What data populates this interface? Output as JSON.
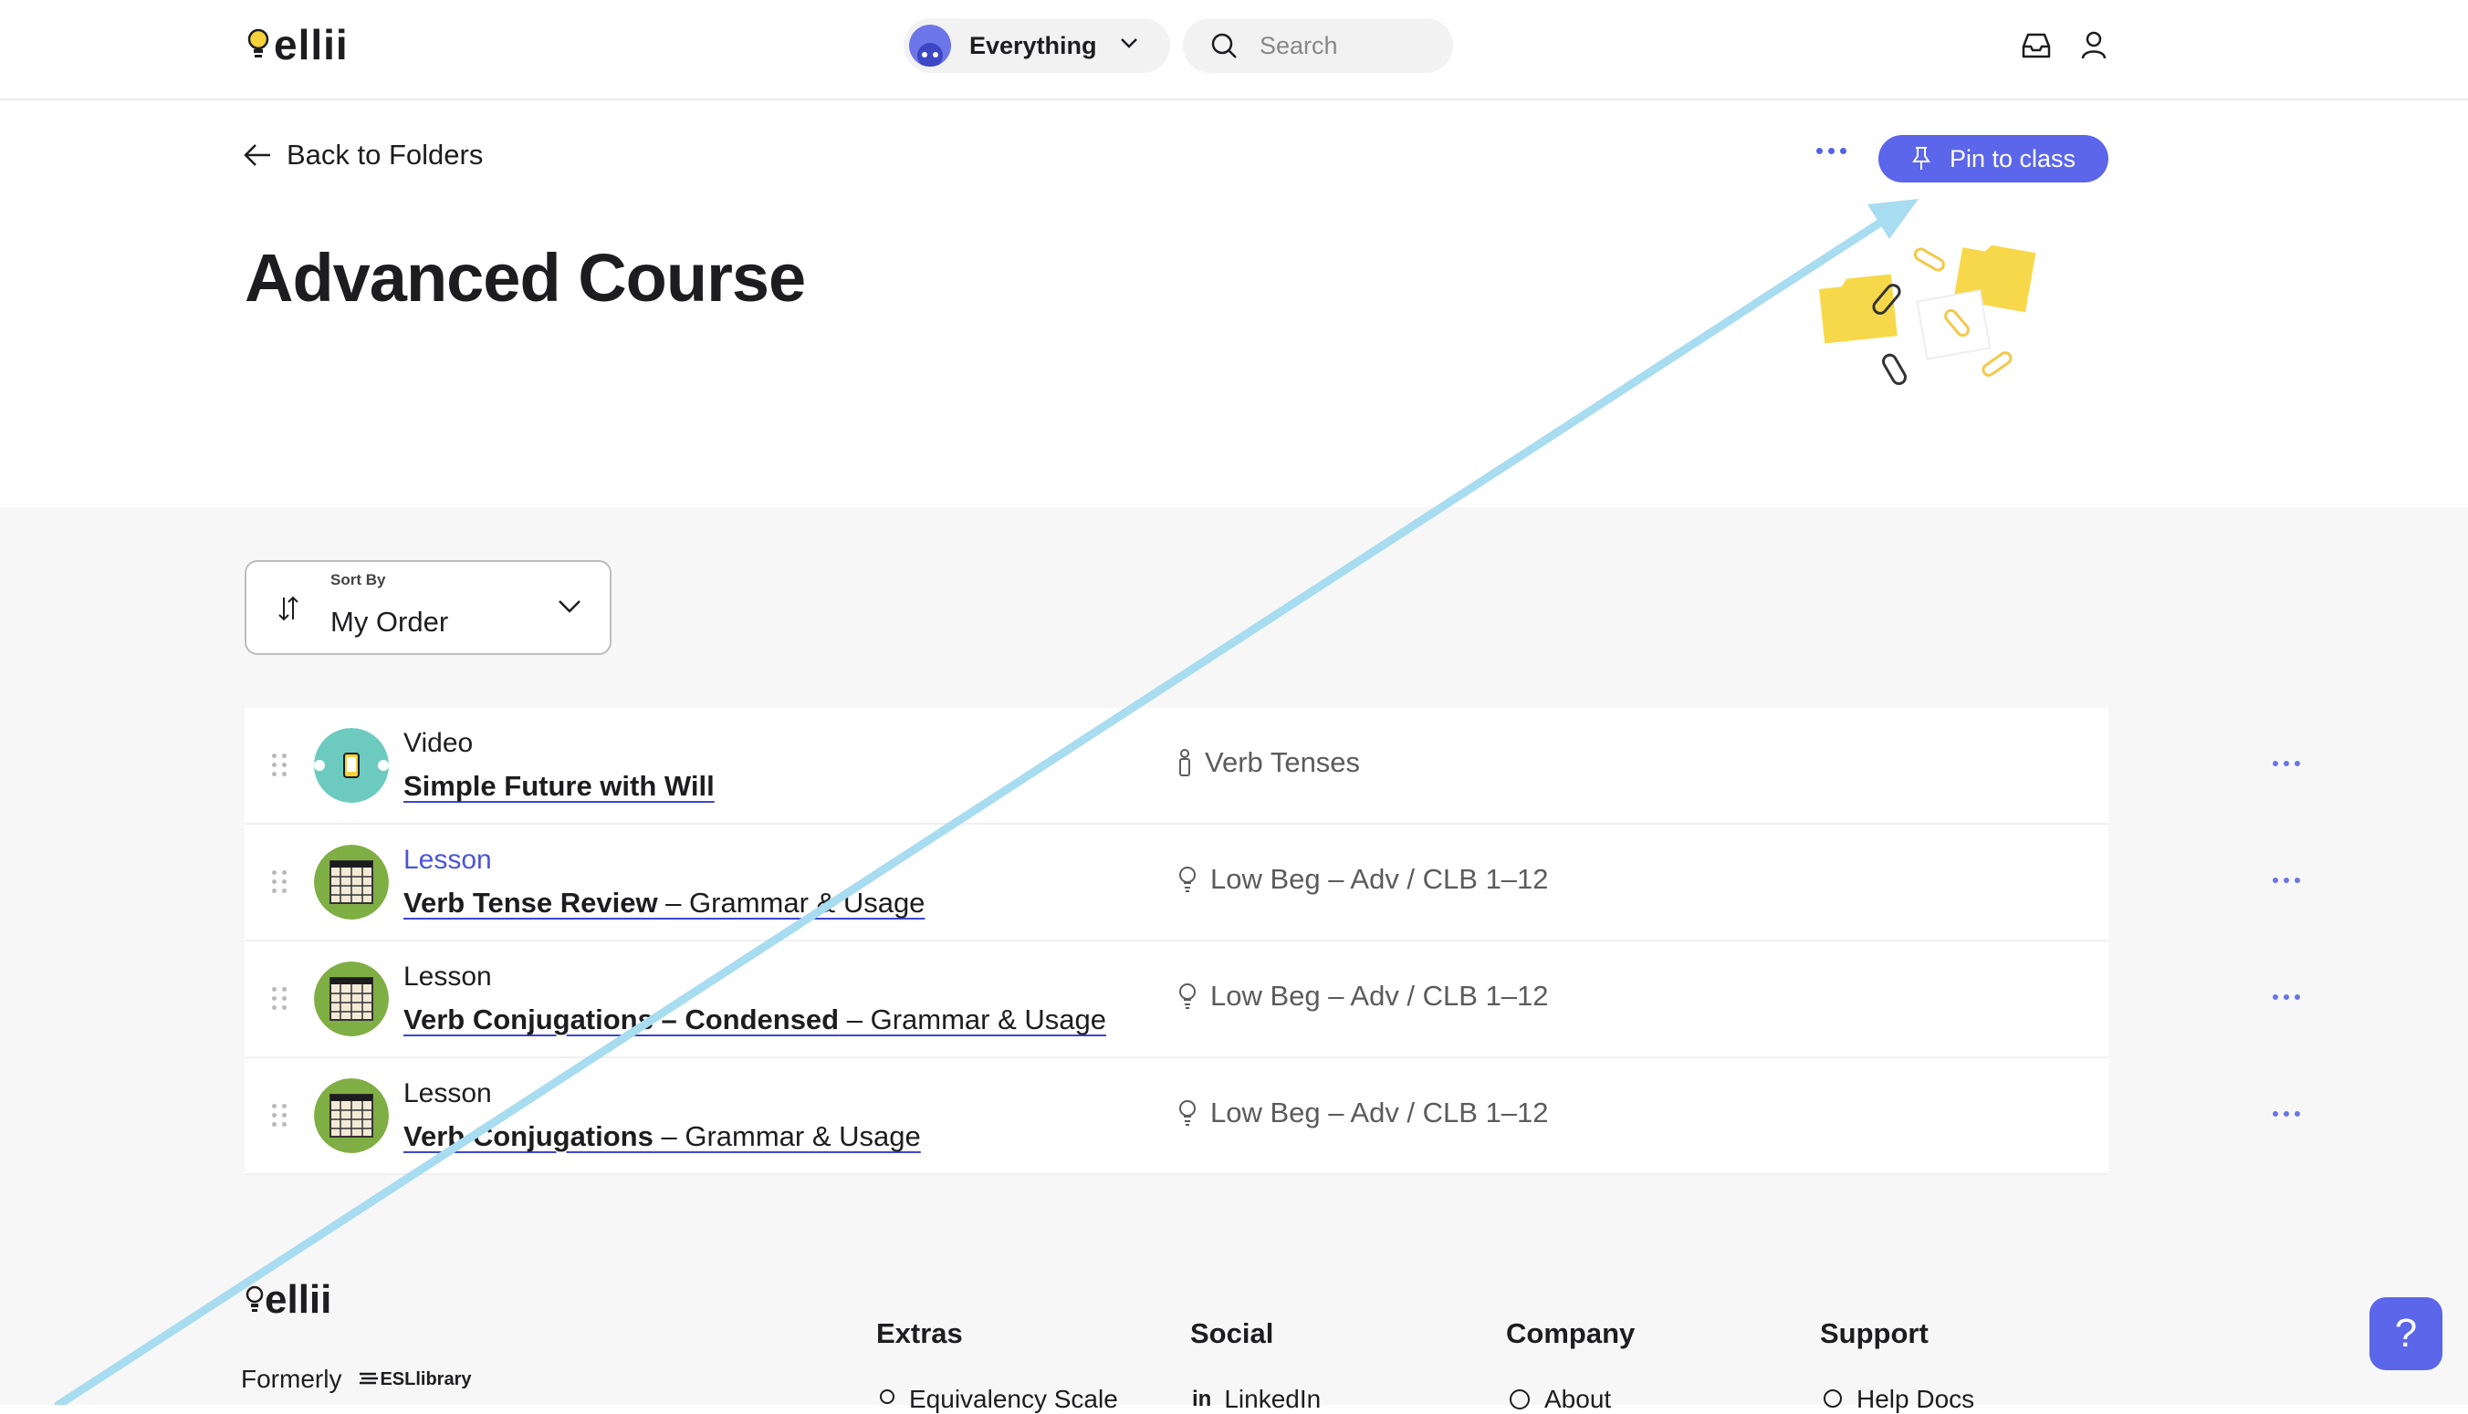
{
  "header": {
    "logo_text": "ellii",
    "scope_label": "Everything",
    "search_placeholder": "Search"
  },
  "top": {
    "back_label": "Back to Folders",
    "pin_label": "Pin to class",
    "page_title": "Advanced Course"
  },
  "sort": {
    "caption": "Sort By",
    "value": "My Order"
  },
  "items": [
    {
      "type": "Video",
      "title_bold": "Simple Future with Will",
      "title_rest": "",
      "meta": "Verb Tenses",
      "meta_icon": "tag-icon"
    },
    {
      "type": "Lesson",
      "title_bold": "Verb Tense Review",
      "title_rest": " – Grammar & Usage",
      "meta": "Low Beg – Adv / CLB 1–12",
      "meta_icon": "lightbulb-icon"
    },
    {
      "type": "Lesson",
      "title_bold": "Verb Conjugations – Condensed",
      "title_rest": " – Grammar & Usage",
      "meta": "Low Beg – Adv / CLB 1–12",
      "meta_icon": "lightbulb-icon"
    },
    {
      "type": "Lesson",
      "title_bold": "Verb Conjugations",
      "title_rest": " – Grammar & Usage",
      "meta": "Low Beg – Adv / CLB 1–12",
      "meta_icon": "lightbulb-icon"
    }
  ],
  "footer": {
    "logo_text": "ellii",
    "formerly": "Formerly",
    "esl_logo": "ESLlibrary",
    "columns": {
      "extras": "Extras",
      "social": "Social",
      "company": "Company",
      "support": "Support"
    },
    "links": {
      "extras": "Equivalency Scale",
      "social": "LinkedIn",
      "company": "About",
      "support": "Help Docs"
    },
    "help_label": "?"
  },
  "colors": {
    "accent": "#5b66ea",
    "link_underline": "#3c46d0",
    "folder_yellow": "#f7d84a",
    "arrow": "#a8dcf0",
    "lesson_green": "#7fae45",
    "video_teal": "#6ccbbe"
  }
}
